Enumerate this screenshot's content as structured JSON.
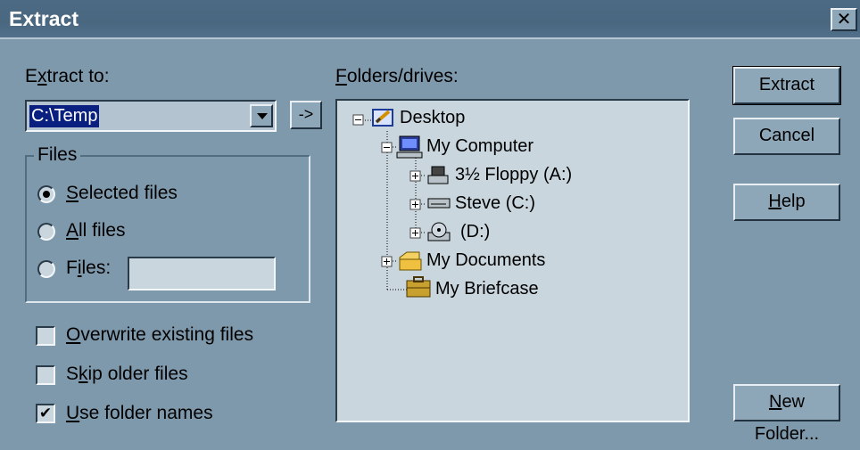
{
  "window": {
    "title": "Extract",
    "close_glyph": "✕"
  },
  "extract_to": {
    "label_pre": "E",
    "label_u": "x",
    "label_post": "tract to:",
    "value": "C:\\Temp",
    "go_button": "->"
  },
  "files_group": {
    "title": "Files",
    "selected": {
      "u": "S",
      "rest": "elected files",
      "checked": true
    },
    "all": {
      "u": "A",
      "rest": "ll files",
      "checked": false
    },
    "files": {
      "pre": "F",
      "u": "i",
      "post": "les:",
      "checked": false,
      "value": ""
    }
  },
  "options": {
    "overwrite": {
      "u": "O",
      "rest": "verwrite existing files",
      "checked": false
    },
    "skip_older": {
      "pre": "S",
      "u": "k",
      "post": "ip older files",
      "checked": false
    },
    "use_folder_names": {
      "u": "U",
      "rest": "se folder names",
      "checked": true
    }
  },
  "folders": {
    "label_u": "F",
    "label_rest": "olders/drives:",
    "tree": [
      {
        "label": "Desktop",
        "icon": "desktop-icon"
      },
      {
        "label": "My Computer",
        "icon": "computer-icon"
      },
      {
        "label": "3½ Floppy (A:)",
        "icon": "floppy-drive-icon"
      },
      {
        "label": "Steve (C:)",
        "icon": "hard-drive-icon"
      },
      {
        "label": "(D:)",
        "icon": "cd-drive-icon"
      },
      {
        "label": "My Documents",
        "icon": "folder-icon"
      },
      {
        "label": "My Briefcase",
        "icon": "briefcase-icon"
      }
    ]
  },
  "buttons": {
    "extract": "Extract",
    "cancel": "Cancel",
    "help_u": "H",
    "help_rest": "elp",
    "new_folder_u": "N",
    "new_folder_rest": "ew Folder..."
  },
  "colors": {
    "dialog_bg": "#7f99ac",
    "title_bg": "#4a6780",
    "selection": "#0a2080"
  }
}
